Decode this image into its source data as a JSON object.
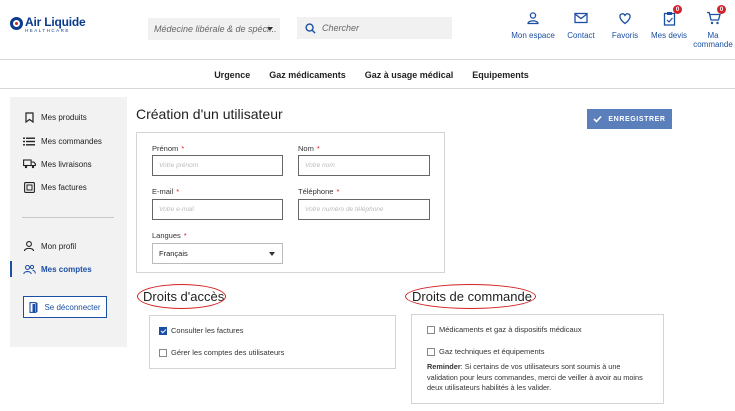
{
  "header": {
    "logo_main": "Air Liquide",
    "logo_sub": "HEALTHCARE",
    "specialty_select": "Médecine libérale & de spéci...",
    "search_placeholder": "Chercher",
    "nav": [
      {
        "icon": "user-icon",
        "label": "Mon espace"
      },
      {
        "icon": "envelope-icon",
        "label": "Contact"
      },
      {
        "icon": "heart-icon",
        "label": "Favoris"
      },
      {
        "icon": "clipboard-icon",
        "label": "Mes devis",
        "badge": "0"
      },
      {
        "icon": "cart-icon",
        "label": "Ma commande",
        "badge": "0"
      }
    ]
  },
  "menu": [
    "Urgence",
    "Gaz médicaments",
    "Gaz à usage médical",
    "Equipements"
  ],
  "sidebar": {
    "items": [
      {
        "icon": "bookmark-icon",
        "label": "Mes produits"
      },
      {
        "icon": "list-icon",
        "label": "Mes commandes"
      },
      {
        "icon": "truck-icon",
        "label": "Mes livraisons"
      },
      {
        "icon": "invoice-icon",
        "label": "Mes factures"
      },
      {
        "icon": "profile-icon",
        "label": "Mon profil"
      },
      {
        "icon": "users-icon",
        "label": "Mes comptes",
        "active": true
      }
    ],
    "logout_label": "Se déconnecter"
  },
  "page": {
    "title": "Création d'un utilisateur",
    "save_label": "ENREGISTRER"
  },
  "form": {
    "first_name": {
      "label": "Prénom",
      "placeholder": "Votre prénom"
    },
    "last_name": {
      "label": "Nom",
      "placeholder": "Votre nom"
    },
    "email": {
      "label": "E-mail",
      "placeholder": "Votre e-mail"
    },
    "phone": {
      "label": "Téléphone",
      "placeholder": "Votre numéro de téléphone"
    },
    "language": {
      "label": "Langues",
      "value": "Français"
    },
    "required_mark": "*"
  },
  "access_rights": {
    "title": "Droits d'accès",
    "options": [
      {
        "label": "Consulter les factures",
        "checked": true
      },
      {
        "label": "Gérer les comptes des utilisateurs",
        "checked": false
      }
    ]
  },
  "order_rights": {
    "title": "Droits de commande",
    "options": [
      {
        "label": "Médicaments et gaz à dispositifs médicaux",
        "checked": false
      },
      {
        "label": "Gaz techniques et équipements",
        "checked": false
      }
    ],
    "reminder_label": "Reminder",
    "reminder_text": ": Si certains de vos utilisateurs sont soumis à une validation pour leurs commandes, merci de veiller à avoir au moins deux utilisateurs habilités à les valider."
  },
  "colors": {
    "brand_blue": "#1b4fa3",
    "button_blue": "#5b7fba",
    "alert_red": "#d3232d",
    "annotation_red": "#d32020"
  }
}
